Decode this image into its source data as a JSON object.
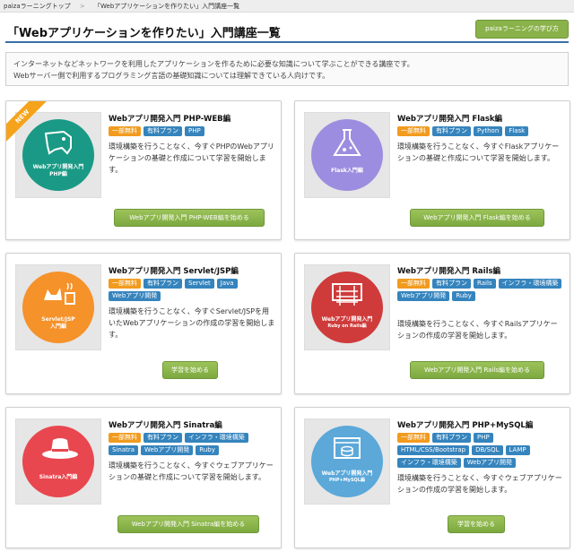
{
  "breadcrumb": {
    "home": "paizaラーニングトップ",
    "separator": ">",
    "current": "「Webアプリケーションを作りたい」入門講座一覧"
  },
  "header": {
    "title": "「Webアプリケーションを作りたい」入門講座一覧",
    "howto_button": "paizaラーニングの学び方"
  },
  "intro": {
    "line1": "インターネットなどネットワークを利用したアプリケーションを作るために必要な知識について学ぶことができる講座です。",
    "line2": "Webサーバー側で利用するプログラミング言語の基礎知識については理解できている人向けです。"
  },
  "courses": [
    {
      "title": "Webアプリ開発入門 PHP-WEB編",
      "badge": "NEW",
      "thumb_label_1": "Webアプリ開発入門",
      "thumb_label_2": "PHP編",
      "thumb_color": "#1a9a86",
      "icon": "php-elephant-icon",
      "tags": [
        {
          "label": "一部無料",
          "kind": "free"
        },
        {
          "label": "有料プラン",
          "kind": "paid"
        },
        {
          "label": "PHP",
          "kind": "paid"
        }
      ],
      "description": "環境構築を行うことなく、今すぐPHPのWebアプリケーションの基礎と作成について学習を開始します。",
      "button": "Webアプリ開発入門 PHP-WEB編を始める"
    },
    {
      "title": "Webアプリ開発入門 Flask編",
      "thumb_label_1": "Flask入門編",
      "thumb_label_2": "",
      "thumb_color": "#9d8de0",
      "icon": "flask-icon",
      "tags": [
        {
          "label": "一部無料",
          "kind": "free"
        },
        {
          "label": "有料プラン",
          "kind": "paid"
        },
        {
          "label": "Python",
          "kind": "paid"
        },
        {
          "label": "Flask",
          "kind": "paid"
        }
      ],
      "description": "環境構築を行うことなく、今すぐFlaskアプリケーションの基礎と作成について学習を開始します。",
      "button": "Webアプリ開発入門 Flask編を始める"
    },
    {
      "title": "Webアプリ開発入門 Servlet/JSP編",
      "thumb_label_1": "Servlet/JSP",
      "thumb_label_2": "入門編",
      "thumb_color": "#f5922a",
      "icon": "cat-coffee-icon",
      "tags": [
        {
          "label": "一部無料",
          "kind": "free"
        },
        {
          "label": "有料プラン",
          "kind": "paid"
        },
        {
          "label": "Servlet",
          "kind": "paid"
        },
        {
          "label": "Java",
          "kind": "paid"
        },
        {
          "label": "Webアプリ開発",
          "kind": "paid"
        }
      ],
      "description": "環境構築を行うことなく、今すぐServlet/JSPを用いたWebアプリケーションの作成の学習を開始します。",
      "button": "学習を始める"
    },
    {
      "title": "Webアプリ開発入門 Rails編",
      "thumb_label_1": "Webアプリ開発入門",
      "thumb_label_2": "Ruby on Rails編",
      "thumb_color": "#cf3b3b",
      "icon": "rails-track-icon",
      "tags": [
        {
          "label": "一部無料",
          "kind": "free"
        },
        {
          "label": "有料プラン",
          "kind": "paid"
        },
        {
          "label": "Rails",
          "kind": "paid"
        },
        {
          "label": "インフラ・環境構築",
          "kind": "paid"
        },
        {
          "label": "Webアプリ開発",
          "kind": "paid"
        },
        {
          "label": "Ruby",
          "kind": "paid"
        }
      ],
      "description": "環境構築を行うことなく、今すぐRailsアプリケーションの作成の学習を開始します。",
      "button": "Webアプリ開発入門 Rails編を始める"
    },
    {
      "title": "Webアプリ開発入門 Sinatra編",
      "thumb_label_1": "Sinatra入門編",
      "thumb_label_2": "",
      "thumb_color": "#e8474f",
      "icon": "hat-icon",
      "tags": [
        {
          "label": "一部無料",
          "kind": "free"
        },
        {
          "label": "有料プラン",
          "kind": "paid"
        },
        {
          "label": "インフラ・環境構築",
          "kind": "paid"
        },
        {
          "label": "Sinatra",
          "kind": "paid"
        },
        {
          "label": "Webアプリ開発",
          "kind": "paid"
        },
        {
          "label": "Ruby",
          "kind": "paid"
        }
      ],
      "description": "環境構築を行うことなく、今すぐウェブアプリケーションの基礎と作成について学習を開始します。",
      "button": "Webアプリ開発入門 Sinatra編を始める"
    },
    {
      "title": "Webアプリ開発入門 PHP+MySQL編",
      "thumb_label_1": "Webアプリ開発入門",
      "thumb_label_2": "PHP+MySQL編",
      "thumb_color": "#5ba8d9",
      "icon": "database-window-icon",
      "tags": [
        {
          "label": "一部無料",
          "kind": "free"
        },
        {
          "label": "有料プラン",
          "kind": "paid"
        },
        {
          "label": "PHP",
          "kind": "paid"
        },
        {
          "label": "HTML/CSS/Bootstrap",
          "kind": "paid"
        },
        {
          "label": "DB/SQL",
          "kind": "paid"
        },
        {
          "label": "LAMP",
          "kind": "paid"
        },
        {
          "label": "インフラ・環境構築",
          "kind": "paid"
        },
        {
          "label": "Webアプリ開発",
          "kind": "paid"
        }
      ],
      "description": "環境構築を行うことなく、今すぐウェブアプリケーションの作成の学習を開始します。",
      "button": "学習を始める"
    }
  ]
}
